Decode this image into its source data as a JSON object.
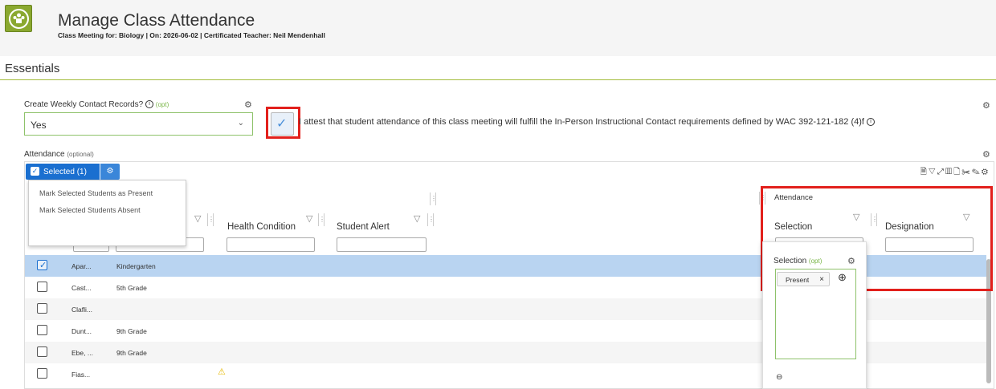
{
  "header": {
    "title": "Manage Class Attendance",
    "subtitle": "Class Meeting for: Biology | On: 2026-06-02 | Certificated Teacher: Neil Mendenhall"
  },
  "section": {
    "title": "Essentials"
  },
  "weekly": {
    "label": "Create Weekly Contact Records?",
    "opt": "(opt)",
    "value": "Yes"
  },
  "attest": {
    "text": "I attest that student attendance of this class meeting will fulfill the In-Person Instructional Contact requirements defined by WAC 392-121-182 (4)f",
    "checked": true
  },
  "attendance": {
    "label": "Attendance",
    "opt": "(optional)"
  },
  "selected": {
    "label": "Selected (1)"
  },
  "menu": {
    "items": [
      "Mark Selected Students as Present",
      "Mark Selected Students Absent"
    ]
  },
  "columns": {
    "health": "Health Condition",
    "alert": "Student Alert",
    "attendance_group": "Attendance",
    "selection": "Selection",
    "designation": "Designation"
  },
  "rows": [
    {
      "name": "Apar...",
      "grade": "Kindergarten",
      "selected": true
    },
    {
      "name": "Cast...",
      "grade": "5th Grade",
      "selected": false
    },
    {
      "name": "Clafli...",
      "grade": "",
      "selected": false
    },
    {
      "name": "Dunt...",
      "grade": "9th Grade",
      "selected": false
    },
    {
      "name": "Ebe, ...",
      "grade": "9th Grade",
      "selected": false
    },
    {
      "name": "Fias...",
      "grade": "",
      "selected": false,
      "warning": true
    }
  ],
  "popup": {
    "label": "Selection",
    "opt": "(opt)",
    "tag": "Present"
  },
  "colors": {
    "brand": "#8aa82f",
    "accent": "#1a6fd0",
    "highlight": "#e2201c",
    "rowSelected": "#b9d4f1"
  },
  "icons": {
    "gear": "gear-icon",
    "info": "info-icon",
    "check": "check-icon",
    "filter": "filter-icon",
    "warning": "warning-icon",
    "zoom": "zoom-in-icon",
    "minus": "minus-circle-icon"
  }
}
